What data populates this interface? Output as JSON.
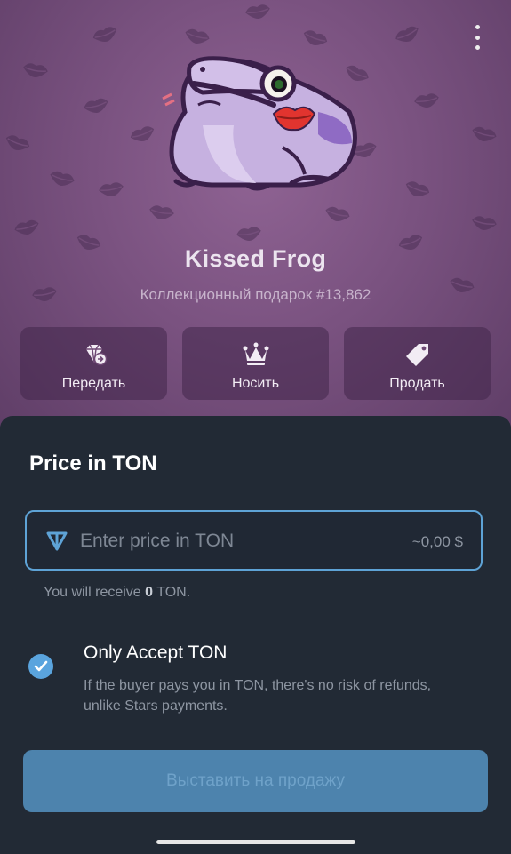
{
  "gift": {
    "title": "Kissed Frog",
    "subtitle": "Коллекционный подарок #13,862"
  },
  "actions": [
    {
      "label": "Передать",
      "icon": "transfer-gem-icon"
    },
    {
      "label": "Носить",
      "icon": "crown-icon"
    },
    {
      "label": "Продать",
      "icon": "price-tag-icon"
    }
  ],
  "sheet": {
    "title": "Price in TON",
    "price_placeholder": "Enter price in TON",
    "price_value": "",
    "usd_estimate": "~0,00 $",
    "receive_prefix": "You will receive ",
    "receive_amount": "0",
    "receive_suffix": " TON.",
    "only_ton": {
      "checked": true,
      "title": "Only Accept TON",
      "description": "If the buyer pays you in TON, there's no risk of refunds, unlike Stars payments."
    },
    "submit_label": "Выставить на продажу"
  },
  "colors": {
    "accent": "#5ea3d6",
    "submit_bg": "#4d83ad",
    "sheet_bg": "#222a35",
    "hero_bg": "#7a5280"
  }
}
